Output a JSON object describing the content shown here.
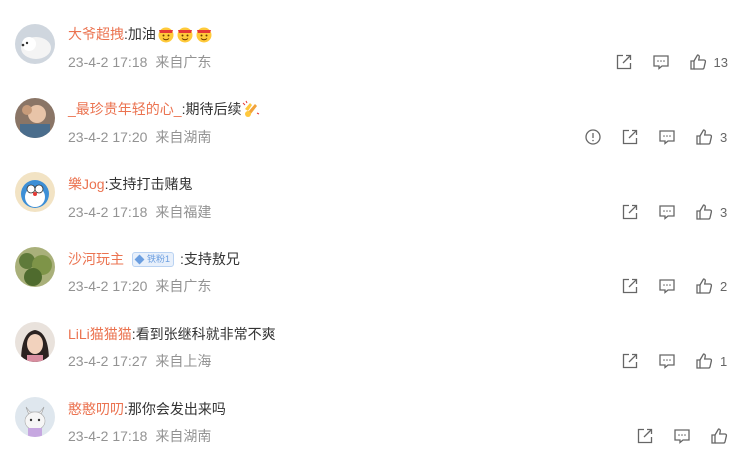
{
  "colors": {
    "username": "#eb7350",
    "meta": "#939393",
    "icon": "#666666"
  },
  "comments": [
    {
      "username": "大爷超拽",
      "sep": ":",
      "text": "加油",
      "emoji_names": [
        "cheer-emoji",
        "cheer-emoji",
        "cheer-emoji"
      ],
      "date": "23-4-2 17:18",
      "location": "来自广东",
      "report": false,
      "likes": "13",
      "avatar": "white-dog"
    },
    {
      "username": "_最珍贵年轻的心_",
      "sep": ":",
      "text": "期待后续",
      "emoji_names": [
        "clap-emoji"
      ],
      "date": "23-4-2 17:20",
      "location": "来自湖南",
      "report": true,
      "likes": "3",
      "avatar": "child-photo"
    },
    {
      "username": "樂Jog",
      "sep": ":",
      "text": "支持打击赌鬼",
      "emoji_names": [],
      "date": "23-4-2 17:18",
      "location": "来自福建",
      "report": false,
      "likes": "3",
      "avatar": "cartoon-face"
    },
    {
      "username": "沙河玩主",
      "badge": "铁粉1",
      "text": ":支持敖兄",
      "emoji_names": [],
      "date": "23-4-2 17:20",
      "location": "来自广东",
      "report": false,
      "likes": "2",
      "avatar": "plants"
    },
    {
      "username": "LiLi猫猫猫",
      "sep": ":",
      "text": "看到张继科就非常不爽",
      "emoji_names": [],
      "date": "23-4-2 17:27",
      "location": "来自上海",
      "report": false,
      "likes": "1",
      "avatar": "girl-photo"
    },
    {
      "username": "憨憨叨叨",
      "sep": ":",
      "text": "那你会发出来吗",
      "emoji_names": [],
      "date": "23-4-2 17:18",
      "location": "来自湖南",
      "report": false,
      "likes": "",
      "avatar": "cat-drawing"
    }
  ]
}
